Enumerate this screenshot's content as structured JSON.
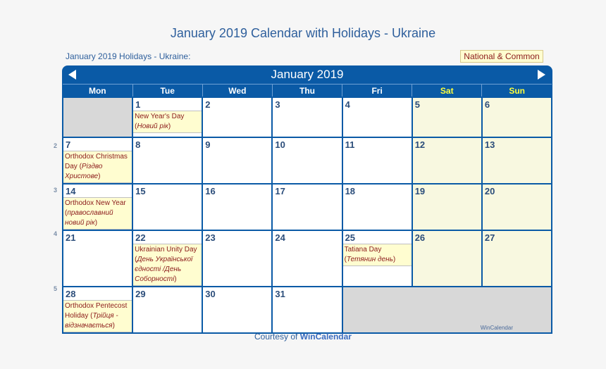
{
  "page": {
    "title": "January 2019 Calendar with Holidays - Ukraine",
    "subtitle": "January 2019 Holidays - Ukraine:",
    "legend": "National & Common",
    "courtesy_prefix": "Courtesy of ",
    "courtesy_brand": "WinCalendar",
    "watermark": "WinCalendar"
  },
  "calendar": {
    "month_label": "January 2019",
    "nav": {
      "prev": "previous-month",
      "next": "next-month"
    },
    "weekdays": [
      "Mon",
      "Tue",
      "Wed",
      "Thu",
      "Fri",
      "Sat",
      "Sun"
    ],
    "week_numbers": [
      "",
      "2",
      "3",
      "4",
      "5"
    ],
    "weeks": [
      [
        {
          "day": "",
          "empty": true
        },
        {
          "day": "1",
          "holiday": {
            "name": "New Year's Day",
            "local": "Новий рік"
          }
        },
        {
          "day": "2"
        },
        {
          "day": "3"
        },
        {
          "day": "4"
        },
        {
          "day": "5"
        },
        {
          "day": "6"
        }
      ],
      [
        {
          "day": "7",
          "holiday": {
            "name": "Orthodox Christmas Day",
            "local": "Різдво Христове"
          }
        },
        {
          "day": "8"
        },
        {
          "day": "9"
        },
        {
          "day": "10"
        },
        {
          "day": "11"
        },
        {
          "day": "12"
        },
        {
          "day": "13"
        }
      ],
      [
        {
          "day": "14",
          "holiday": {
            "name": "Orthodox New Year",
            "local": "православний новий рік"
          }
        },
        {
          "day": "15"
        },
        {
          "day": "16"
        },
        {
          "day": "17"
        },
        {
          "day": "18"
        },
        {
          "day": "19"
        },
        {
          "day": "20"
        }
      ],
      [
        {
          "day": "21"
        },
        {
          "day": "22",
          "holiday": {
            "name": "Ukrainian Unity Day",
            "local": "День Української єдності /День Соборності"
          }
        },
        {
          "day": "23"
        },
        {
          "day": "24"
        },
        {
          "day": "25",
          "holiday": {
            "name": "Tatiana Day",
            "local": "Тетянин день"
          }
        },
        {
          "day": "26"
        },
        {
          "day": "27"
        }
      ],
      [
        {
          "day": "28",
          "holiday": {
            "name": "Orthodox Pentecost Holiday",
            "local": "Трійця - відзначається"
          }
        },
        {
          "day": "29"
        },
        {
          "day": "30"
        },
        {
          "day": "31"
        },
        {
          "day": "",
          "empty": true,
          "span": 3
        }
      ]
    ]
  },
  "colors": {
    "brand_blue": "#0a5aa6",
    "weekend_header": "#ffff3a",
    "weekend_bg": "#f8f8e0",
    "holiday_bg": "#fffdd0",
    "holiday_text": "#8b1a1a",
    "empty_bg": "#d8d8d8"
  }
}
